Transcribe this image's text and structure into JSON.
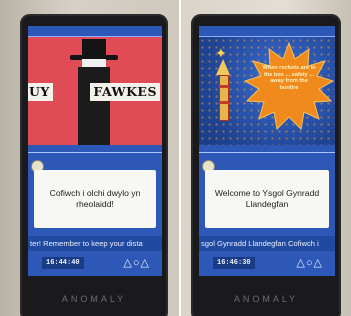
{
  "left_panel": {
    "banner_left": "UY",
    "banner_right": "FAWKES",
    "message": "Cofiwch i olchi dwylo yn rheolaidd!",
    "ticker": "ter!  Remember to keep your dista",
    "clock": "16:44:40",
    "controls": "△○△",
    "brand": "ANOMALY"
  },
  "right_panel": {
    "burst_text": "When rockets are in the box ... safety ... away from the bonfire",
    "message": "Welcome to Ysgol Gynradd Llandegfan",
    "ticker": "sgol Gynradd Llandegfan   Cofiwch i",
    "clock": "16:46:30",
    "controls": "△○△",
    "brand": "ANOMALY"
  },
  "colors": {
    "screen_blue": "#2d58b8",
    "red_art": "#e04b55",
    "burst_orange": "#f08a1c"
  }
}
